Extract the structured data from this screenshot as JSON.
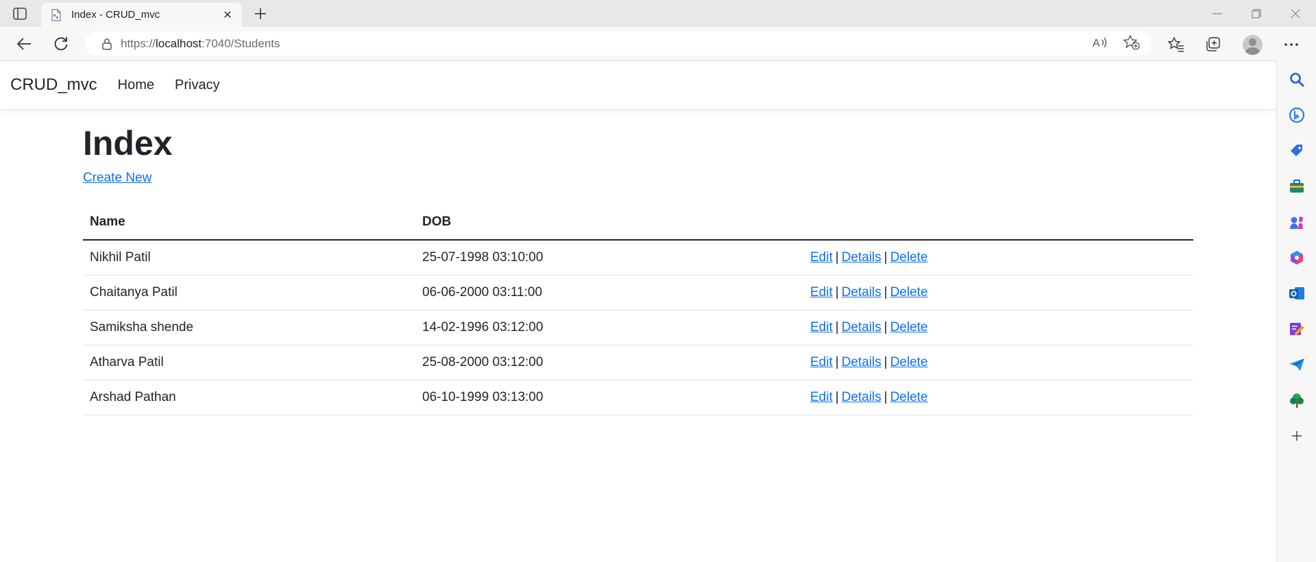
{
  "browser": {
    "tab_title": "Index - CRUD_mvc",
    "url_prefix": "https://",
    "url_host": "localhost",
    "url_rest": ":7040/Students"
  },
  "site": {
    "brand": "CRUD_mvc",
    "nav": [
      {
        "label": "Home"
      },
      {
        "label": "Privacy"
      }
    ]
  },
  "page": {
    "title": "Index",
    "create_link": "Create New",
    "columns": {
      "name": "Name",
      "dob": "DOB"
    },
    "actions": {
      "edit": "Edit",
      "details": "Details",
      "delete": "Delete",
      "separator": "|"
    },
    "rows": [
      {
        "name": "Nikhil Patil",
        "dob": "25-07-1998 03:10:00"
      },
      {
        "name": "Chaitanya Patil",
        "dob": "06-06-2000 03:11:00"
      },
      {
        "name": "Samiksha shende",
        "dob": "14-02-1996 03:12:00"
      },
      {
        "name": "Atharva Patil",
        "dob": "25-08-2000 03:12:00"
      },
      {
        "name": "Arshad Pathan",
        "dob": "06-10-1999 03:13:00"
      }
    ]
  },
  "colors": {
    "link": "#0d6efd",
    "text": "#212529"
  },
  "sidebar_icons": [
    "search-icon",
    "bing-chat-icon",
    "shopping-icon",
    "tools-icon",
    "games-icon",
    "office-icon",
    "outlook-icon",
    "designer-icon",
    "send-icon",
    "tree-icon",
    "add-icon"
  ]
}
